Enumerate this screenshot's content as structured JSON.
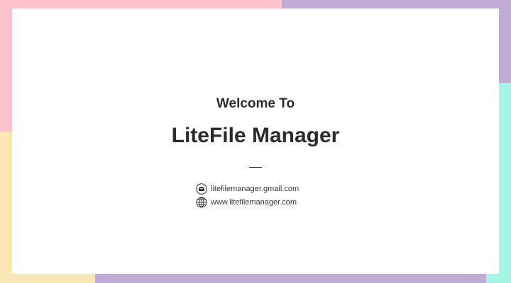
{
  "colors": {
    "pink": "#fbc2cc",
    "purple": "#bfabd6",
    "teal": "#a3f5e6",
    "yellow": "#f8e6b5",
    "text": "#2b2b2b"
  },
  "welcome": {
    "heading": "Welcome To",
    "title": "LiteFile Manager"
  },
  "contact": {
    "email": {
      "icon": "envelope-icon",
      "text": "litefilemanager.gmail.com"
    },
    "website": {
      "icon": "globe-icon",
      "text": "www.litefilemanager.com"
    }
  }
}
